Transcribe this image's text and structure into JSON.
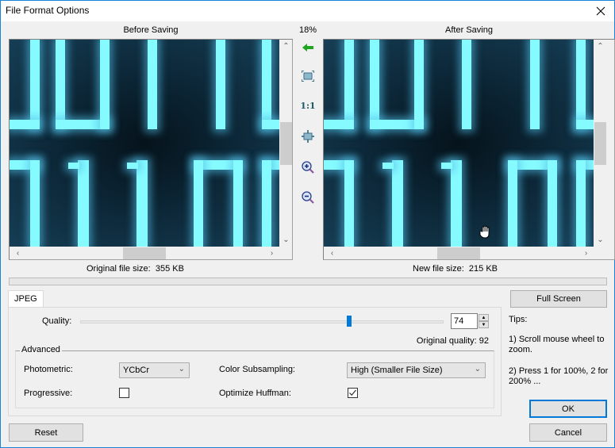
{
  "window": {
    "title": "File Format Options",
    "close_icon": "close-icon"
  },
  "preview": {
    "before_label": "Before Saving",
    "after_label": "After Saving",
    "zoom_level": "18%",
    "original_size_label": "Original file size:",
    "original_size_value": "355 KB",
    "new_size_label": "New file size:",
    "new_size_value": "215 KB",
    "toolbar": [
      {
        "name": "sync-arrow-icon",
        "label": "←"
      },
      {
        "name": "fit-to-window-icon",
        "label": ""
      },
      {
        "name": "actual-size-icon",
        "label": "1:1"
      },
      {
        "name": "fit-width-icon",
        "label": ""
      },
      {
        "name": "zoom-in-icon",
        "label": ""
      },
      {
        "name": "zoom-out-icon",
        "label": ""
      }
    ]
  },
  "tabs": [
    {
      "label": "JPEG",
      "active": true
    }
  ],
  "jpeg": {
    "quality_label": "Quality:",
    "quality_value": "74",
    "quality_percent": 74,
    "original_quality_label": "Original quality: 92",
    "advanced_label": "Advanced",
    "photometric_label": "Photometric:",
    "photometric_value": "YCbCr",
    "color_subsampling_label": "Color Subsampling:",
    "color_subsampling_value": "High (Smaller File Size)",
    "progressive_label": "Progressive:",
    "progressive_checked": false,
    "optimize_huffman_label": "Optimize Huffman:",
    "optimize_huffman_checked": true
  },
  "side": {
    "full_screen_label": "Full Screen",
    "tips_title": "Tips:",
    "tip1": "1) Scroll mouse wheel to zoom.",
    "tip2": "2) Press 1 for 100%, 2 for 200% ..."
  },
  "buttons": {
    "reset": "Reset",
    "ok": "OK",
    "cancel": "Cancel"
  },
  "colors": {
    "accent": "#0078d7",
    "digit_glow": "#86fbff"
  }
}
